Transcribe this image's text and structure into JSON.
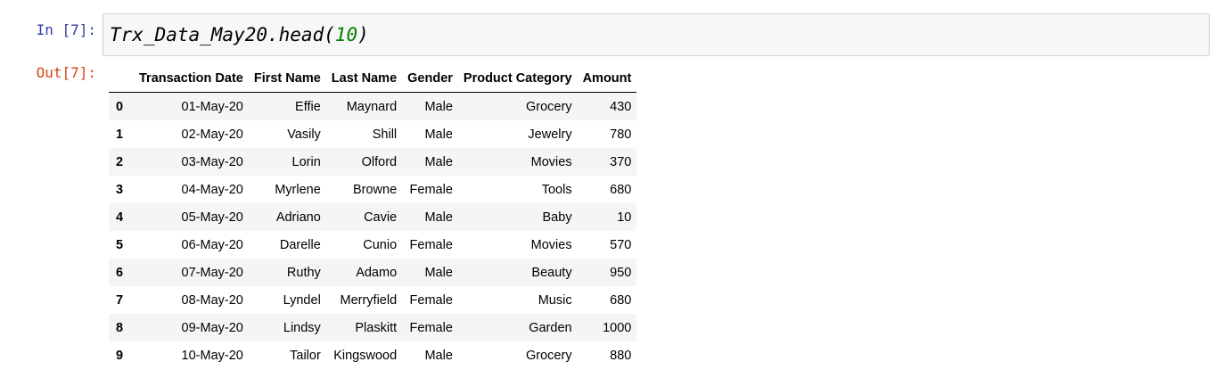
{
  "input_prompt": "In [7]:",
  "output_prompt": "Out[7]:",
  "code": {
    "prefix": "Trx_Data_May20.head(",
    "arg": "10",
    "suffix": ")"
  },
  "dataframe": {
    "columns": [
      "",
      "Transaction Date",
      "First Name",
      "Last Name",
      "Gender",
      "Product Category",
      "Amount"
    ],
    "rows": [
      {
        "index": "0",
        "cells": [
          "01-May-20",
          "Effie",
          "Maynard",
          "Male",
          "Grocery",
          "430"
        ]
      },
      {
        "index": "1",
        "cells": [
          "02-May-20",
          "Vasily",
          "Shill",
          "Male",
          "Jewelry",
          "780"
        ]
      },
      {
        "index": "2",
        "cells": [
          "03-May-20",
          "Lorin",
          "Olford",
          "Male",
          "Movies",
          "370"
        ]
      },
      {
        "index": "3",
        "cells": [
          "04-May-20",
          "Myrlene",
          "Browne",
          "Female",
          "Tools",
          "680"
        ]
      },
      {
        "index": "4",
        "cells": [
          "05-May-20",
          "Adriano",
          "Cavie",
          "Male",
          "Baby",
          "10"
        ]
      },
      {
        "index": "5",
        "cells": [
          "06-May-20",
          "Darelle",
          "Cunio",
          "Female",
          "Movies",
          "570"
        ]
      },
      {
        "index": "6",
        "cells": [
          "07-May-20",
          "Ruthy",
          "Adamo",
          "Male",
          "Beauty",
          "950"
        ]
      },
      {
        "index": "7",
        "cells": [
          "08-May-20",
          "Lyndel",
          "Merryfield",
          "Female",
          "Music",
          "680"
        ]
      },
      {
        "index": "8",
        "cells": [
          "09-May-20",
          "Lindsy",
          "Plaskitt",
          "Female",
          "Garden",
          "1000"
        ]
      },
      {
        "index": "9",
        "cells": [
          "10-May-20",
          "Tailor",
          "Kingswood",
          "Male",
          "Grocery",
          "880"
        ]
      }
    ]
  }
}
